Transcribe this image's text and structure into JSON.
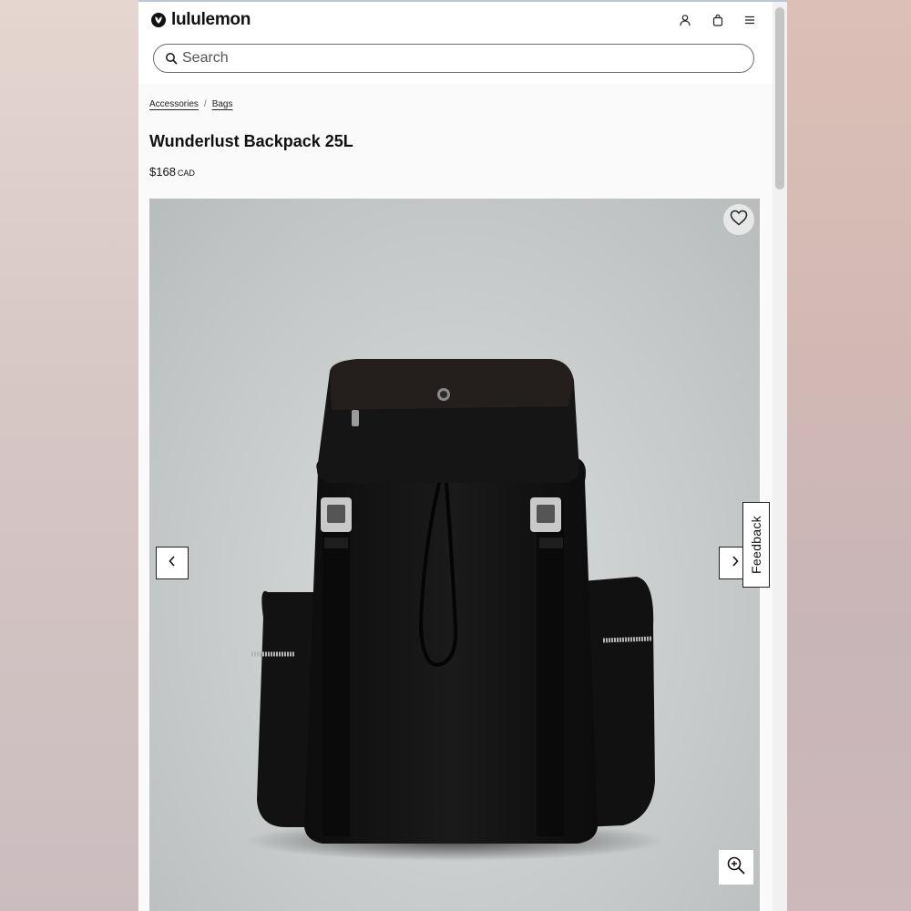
{
  "brand": {
    "name": "lululemon",
    "logo_icon": "lululemon-logo-icon"
  },
  "header": {
    "icons": [
      "account-icon",
      "bag-icon",
      "menu-icon"
    ],
    "search": {
      "placeholder": "Search",
      "value": ""
    }
  },
  "breadcrumb": {
    "items": [
      "Accessories",
      "Bags"
    ],
    "separator": "/"
  },
  "product": {
    "title": "Wunderlust Backpack 25L",
    "price": "$168",
    "currency": "CAD",
    "image_alt": "Black backpack with buckle straps and side pockets"
  },
  "gallery": {
    "icons": [
      "heart-icon",
      "chevron-left-icon",
      "chevron-right-icon",
      "zoom-in-icon"
    ]
  },
  "feedback": {
    "label": "Feedback"
  }
}
